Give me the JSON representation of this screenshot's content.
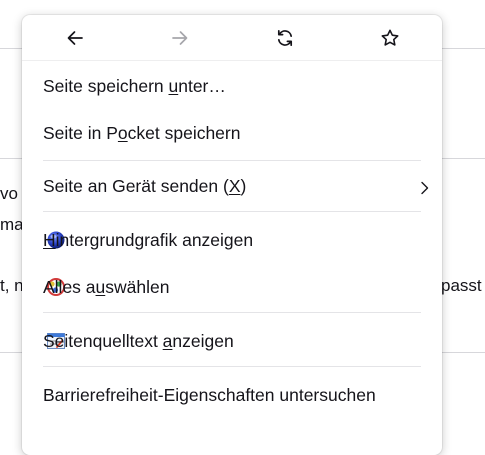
{
  "background": {
    "fragments": [
      "vo",
      "ma",
      "t, n",
      "passt"
    ]
  },
  "navigation": {
    "back_icon": "arrow-left-icon",
    "forward_icon": "arrow-right-icon",
    "reload_icon": "reload-icon",
    "bookmark_icon": "star-icon"
  },
  "menu": {
    "items": [
      {
        "pre": "Seite speichern ",
        "key": "u",
        "post": "nter…"
      },
      {
        "pre": "Seite in P",
        "key": "o",
        "post": "cket speichern"
      },
      {
        "pre": "Seite an Gerät senden (",
        "key": "X",
        "post": ")"
      },
      {
        "pre": "",
        "key": "H",
        "post": "intergrundgrafik anzeigen"
      },
      {
        "pre": "Alles a",
        "key": "u",
        "post": "swählen"
      },
      {
        "pre": "Seitenquelltext ",
        "key": "a",
        "post": "nzeigen"
      },
      {
        "pre": "Barrierefreiheit-Eigenschaften untersuchen",
        "key": "",
        "post": ""
      }
    ]
  },
  "colors": {
    "menu_bg": "#ffffff",
    "text": "#15141a",
    "disabled": "#a6a6ab",
    "separator": "#e4e4e7"
  }
}
